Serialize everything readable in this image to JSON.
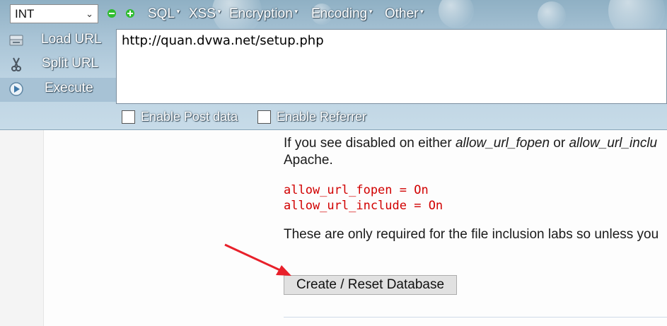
{
  "toolbar": {
    "select_value": "INT",
    "menus": [
      "SQL",
      "XSS",
      "Encryption",
      "Encoding",
      "Other"
    ],
    "side_buttons": {
      "load_url": "Load URL",
      "split_url": "Split URL",
      "execute": "Execute"
    },
    "url_value": "http://quan.dvwa.net/setup.php",
    "checkboxes": {
      "post_data": "Enable Post data",
      "referrer": "Enable Referrer"
    }
  },
  "content": {
    "para1_line1_a": "If you see disabled on either ",
    "para1_fopen": "allow_url_fopen",
    "para1_or": " or ",
    "para1_include": "allow_url_inclu",
    "para1_line2": "Apache.",
    "code1": "allow_url_fopen = On",
    "code2": "allow_url_include = On",
    "para2": "These are only required for the file inclusion labs so unless you",
    "button_label": "Create / Reset Database"
  },
  "colors": {
    "code_text": "#d10000",
    "arrow": "#e8202a",
    "toolbar_bg": "#b4cddd"
  }
}
